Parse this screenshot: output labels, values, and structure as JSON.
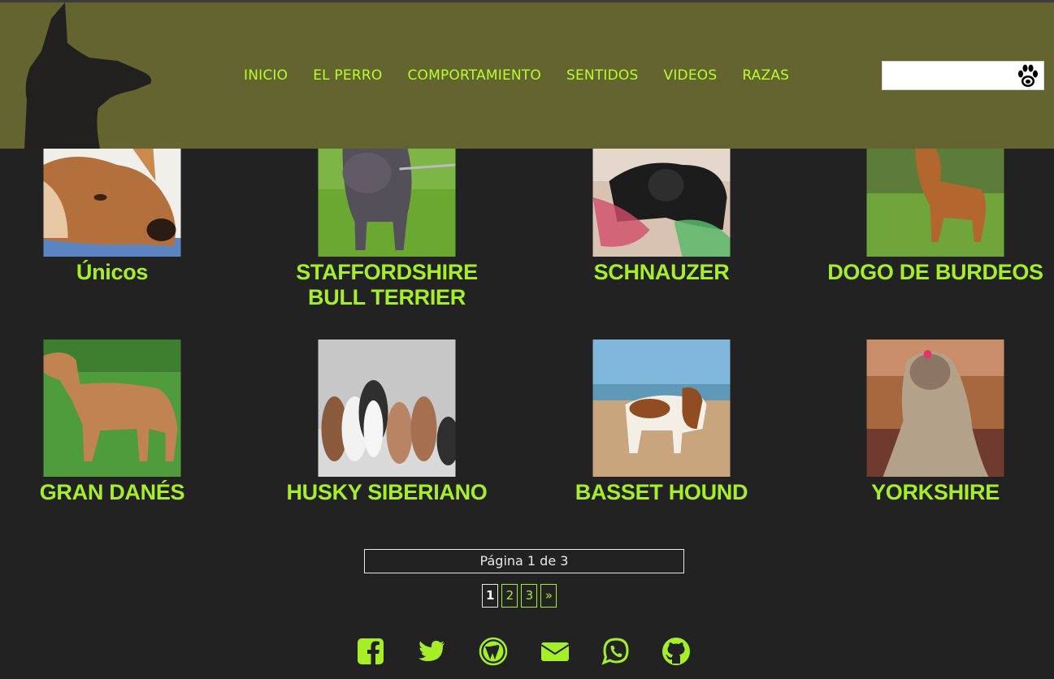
{
  "nav": {
    "items": [
      "INICIO",
      "EL PERRO",
      "COMPORTAMIENTO",
      "SENTIDOS",
      "VIDEOS",
      "RAZAS"
    ]
  },
  "search": {
    "value": "",
    "placeholder": ""
  },
  "breeds": {
    "row1": [
      "Únicos",
      "STAFFORDSHIRE BULL TERRIER",
      "SCHNAUZER",
      "DOGO DE BURDEOS"
    ],
    "row2": [
      "GRAN DANÉS",
      "HUSKY SIBERIANO",
      "BASSET HOUND",
      "YORKSHIRE"
    ]
  },
  "pagination": {
    "info": "Página 1 de 3",
    "pages": [
      "1",
      "2",
      "3"
    ],
    "next": "»",
    "current": "1"
  },
  "social": [
    "facebook-icon",
    "twitter-icon",
    "wordpress-icon",
    "email-icon",
    "whatsapp-icon",
    "github-icon"
  ],
  "colors": {
    "header": "#636430",
    "accent": "#a6ee28",
    "nav": "#b7ff2b",
    "background": "#222222"
  }
}
